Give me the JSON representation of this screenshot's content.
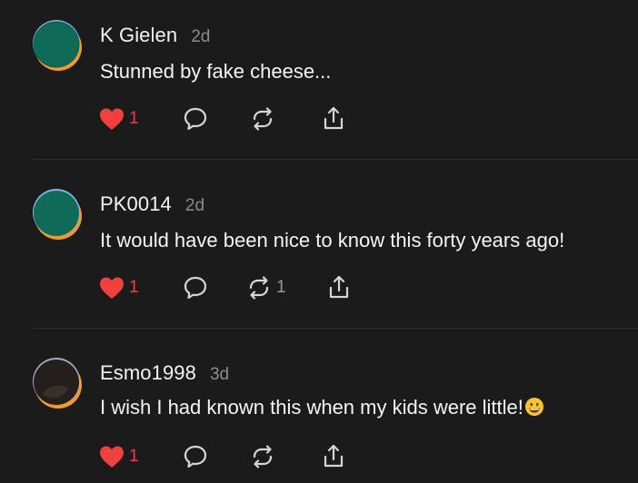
{
  "colors": {
    "background": "#1b1b1c",
    "text": "#f4f4f4",
    "muted": "#8c8c8f",
    "like_red": "#f2403f",
    "divider": "#2e2e30"
  },
  "icons": {
    "like": "heart-icon",
    "reply": "speech-bubble-icon",
    "restack": "repeat-arrows-icon",
    "share": "share-upload-icon"
  },
  "comments": [
    {
      "username": "K Gielen",
      "time": "2d",
      "text": "Stunned by fake cheese...",
      "emoji": "",
      "likes": "1",
      "liked": true,
      "restacks": ""
    },
    {
      "username": "PK0014",
      "time": "2d",
      "text": "It would have been nice to know this forty years ago!",
      "emoji": "",
      "likes": "1",
      "liked": true,
      "restacks": "1"
    },
    {
      "username": "Esmo1998",
      "time": "3d",
      "text": "I wish I had known this when my kids were little!",
      "emoji": "grinning-face",
      "likes": "1",
      "liked": true,
      "restacks": ""
    }
  ]
}
